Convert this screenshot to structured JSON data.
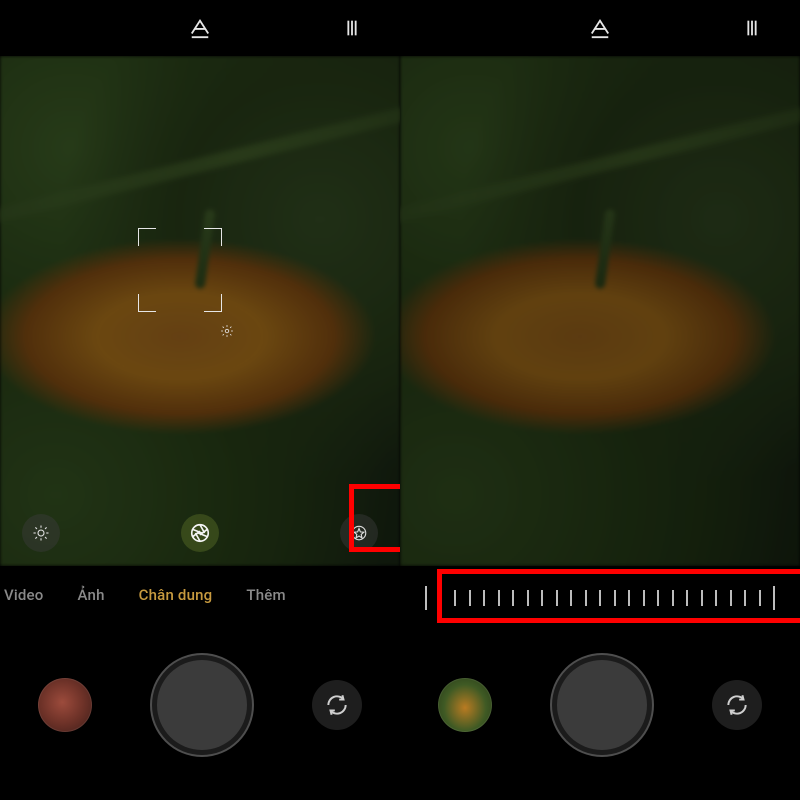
{
  "left": {
    "modes": {
      "video": "Video",
      "photo": "Ảnh",
      "portrait": "Chân dung",
      "more": "Thêm",
      "active": "portrait"
    },
    "icons": {
      "ai_toggle": "ai-toggle-icon",
      "menu": "menu-lines-icon",
      "aperture": "aperture-icon",
      "brightness": "brightness-icon",
      "filter_star": "filter-star-icon",
      "flip": "camera-flip-icon"
    }
  },
  "right": {
    "slider": {
      "tick_count": 25,
      "cursor_index": 1
    },
    "icons": {
      "ai_toggle": "ai-toggle-icon",
      "menu": "menu-lines-icon",
      "flip": "camera-flip-icon"
    }
  }
}
